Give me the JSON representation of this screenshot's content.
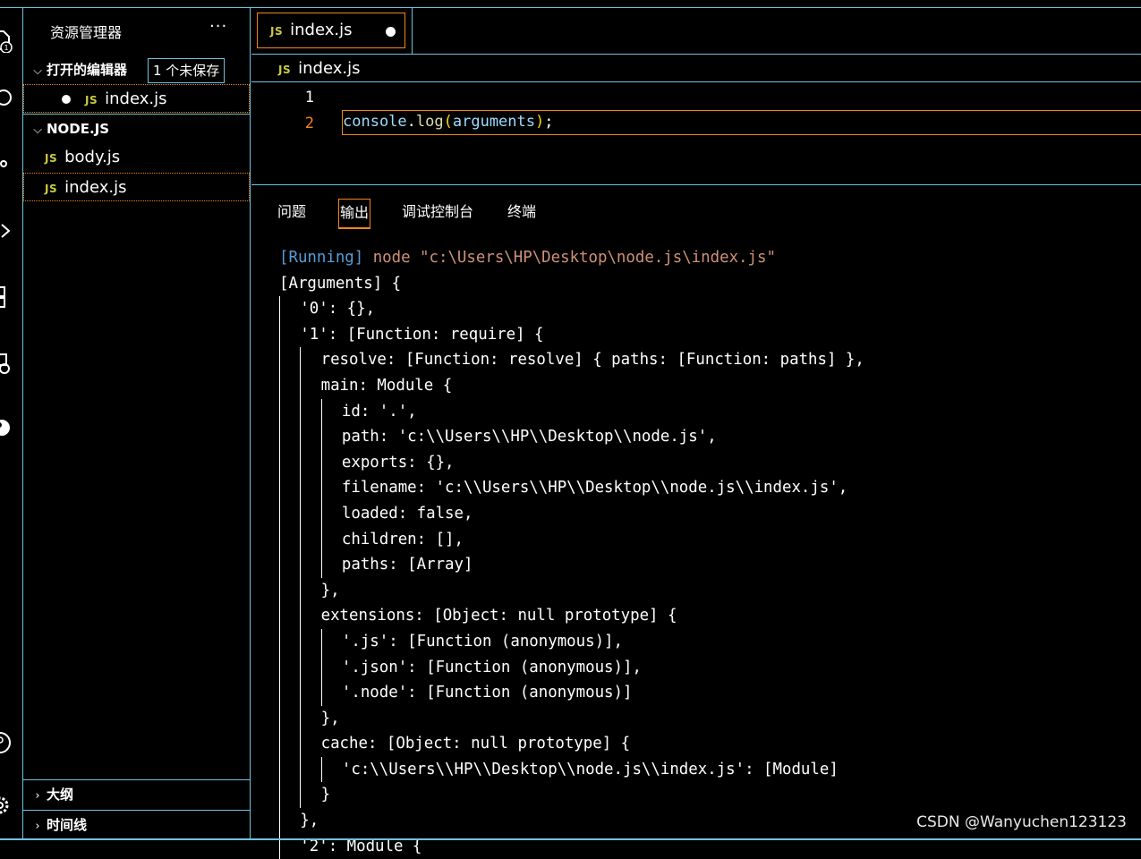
{
  "explorer": {
    "title": "资源管理器",
    "more": "···",
    "open_editors": {
      "label": "打开的编辑器",
      "unsaved_badge": "1 个未保存",
      "files": [
        {
          "icon": "JS",
          "name": "index.js",
          "dirty": true
        }
      ]
    },
    "folder": {
      "label": "NODE.JS",
      "files": [
        {
          "icon": "JS",
          "name": "body.js"
        },
        {
          "icon": "JS",
          "name": "index.js"
        }
      ]
    },
    "outline_label": "大纲",
    "timeline_label": "时间线"
  },
  "editor": {
    "tab": {
      "icon": "JS",
      "name": "index.js"
    },
    "breadcrumb": {
      "icon": "JS",
      "name": "index.js"
    },
    "line_numbers": [
      "1",
      "2"
    ],
    "code": {
      "ident": "console",
      "dot": ".",
      "fn": "log",
      "open": "(",
      "arg": "arguments",
      "close": ")",
      "end": ";"
    }
  },
  "panel": {
    "tabs": [
      "问题",
      "输出",
      "调试控制台",
      "终端"
    ],
    "active_tab": "输出",
    "running_tag": "[Running]",
    "running_cmd": " node \"c:\\Users\\HP\\Desktop\\node.js\\index.js\"",
    "lines": [
      "[Arguments] {",
      "'0': {},",
      "'1': [Function: require] {",
      "resolve: [Function: resolve] { paths: [Function: paths] },",
      "main: Module {",
      "id: '.',",
      "path: 'c:\\\\Users\\\\HP\\\\Desktop\\\\node.js',",
      "exports: {},",
      "filename: 'c:\\\\Users\\\\HP\\\\Desktop\\\\node.js\\\\index.js',",
      "loaded: false,",
      "children: [],",
      "paths: [Array]",
      "},",
      "extensions: [Object: null prototype] {",
      "'.js': [Function (anonymous)],",
      "'.json': [Function (anonymous)],",
      "'.node': [Function (anonymous)]",
      "},",
      "cache: [Object: null prototype] {",
      "'c:\\\\Users\\\\HP\\\\Desktop\\\\node.js\\\\index.js': [Module]",
      "}",
      "},",
      "'2': Module {"
    ]
  },
  "watermark": "CSDN @Wanyuchen123123"
}
